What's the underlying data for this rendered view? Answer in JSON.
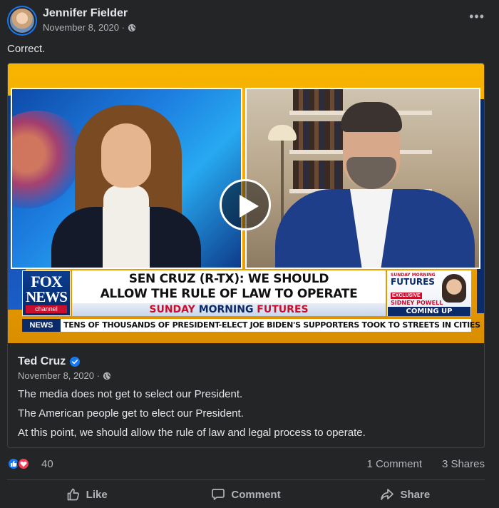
{
  "post": {
    "author": "Jennifer Fielder",
    "date": "November 8, 2020 ·",
    "text": "Correct.",
    "more_label": "•••"
  },
  "video": {
    "headline_line1": "SEN CRUZ (R-TX): WE SHOULD",
    "headline_line2": "ALLOW THE RULE OF LAW TO OPERATE",
    "show_part1": "SUNDAY ",
    "show_part2": "MORNING",
    "show_part3": " FUTURES",
    "logo_fox": "FOX",
    "logo_news": "NEWS",
    "logo_channel": "channel",
    "promo_small": "SUNDAY MORNING",
    "promo_title": "FUTURES",
    "promo_exclusive": "EXCLUSIVE",
    "promo_guest": "SIDNEY POWELL",
    "promo_coming": "COMING UP",
    "ticker_label": "NEWS",
    "ticker_text": "TENS OF THOUSANDS OF PRESIDENT-ELECT JOE BIDEN'S SUPPORTERS TOOK TO STREETS IN CITIES"
  },
  "shared": {
    "author": "Ted Cruz",
    "date": "November 8, 2020 ·",
    "lines": [
      "The media does not get to select our President.",
      "The American people get to elect our President.",
      "At this point, we should allow the rule of law and legal process to operate."
    ]
  },
  "stats": {
    "reaction_count": "40",
    "comments": "1 Comment",
    "shares": "3 Shares"
  },
  "actions": {
    "like": "Like",
    "comment": "Comment",
    "share": "Share"
  },
  "colors": {
    "background": "#242526",
    "text_primary": "#e4e6eb",
    "text_secondary": "#b0b3b8",
    "facebook_blue": "#1877f2",
    "love_red": "#f33e58"
  }
}
